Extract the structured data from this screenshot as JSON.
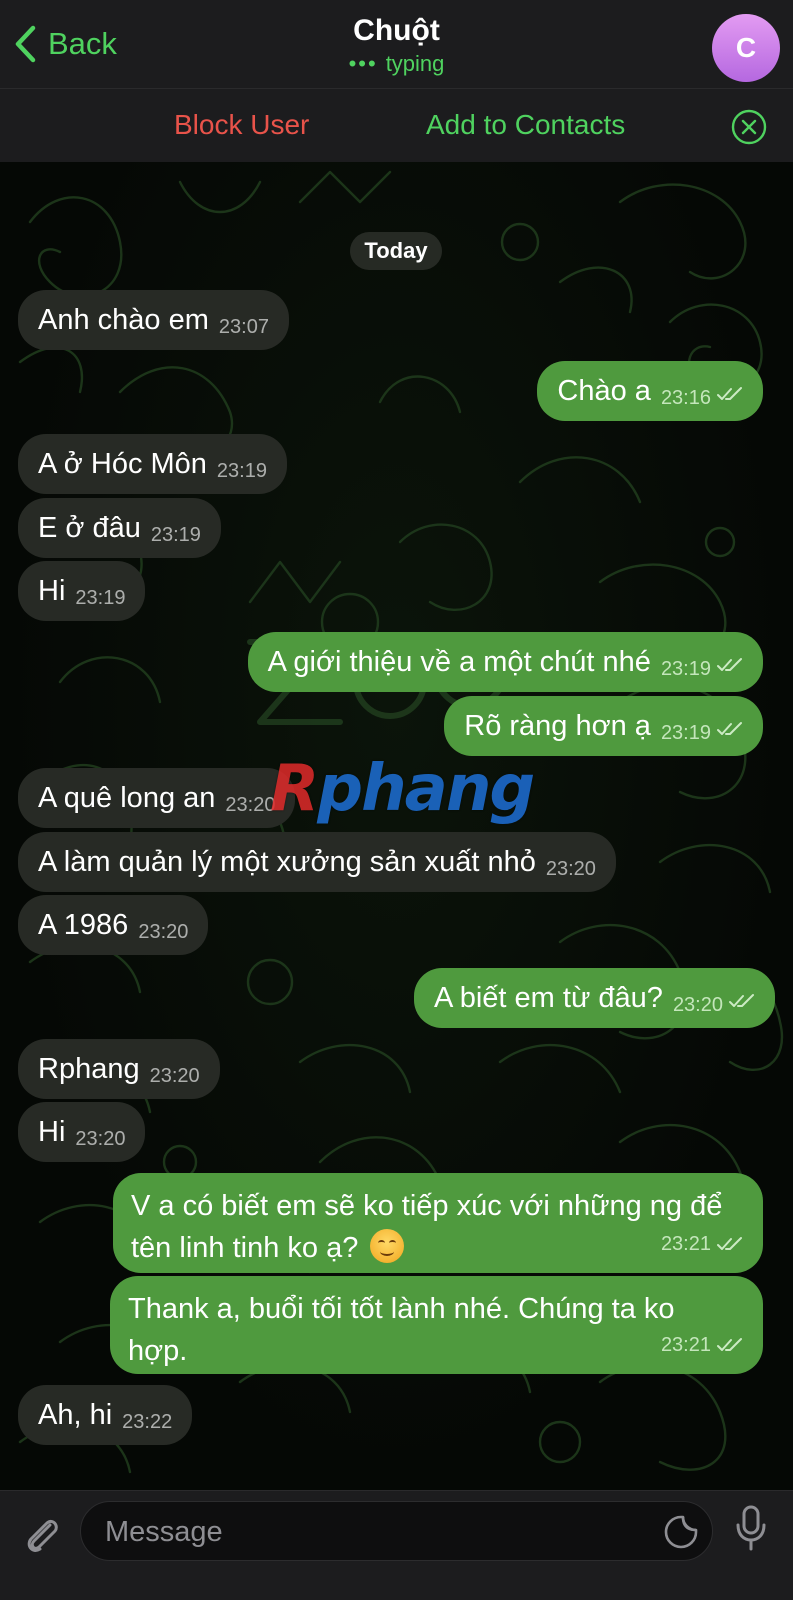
{
  "header": {
    "back_label": "Back",
    "contact_name": "Chuột",
    "status_dots": "•••",
    "status": "typing",
    "avatar_initial": "C"
  },
  "action_bar": {
    "block_label": "Block User",
    "add_label": "Add to Contacts"
  },
  "chat": {
    "date_label": "Today",
    "watermark": {
      "first": "R",
      "rest": "phang"
    },
    "messages": [
      {
        "dir": "in",
        "text": "Anh chào em",
        "time": "23:07"
      },
      {
        "dir": "out",
        "text": "Chào a",
        "time": "23:16",
        "read": true
      },
      {
        "dir": "in",
        "text": "A ở Hóc Môn",
        "time": "23:19"
      },
      {
        "dir": "in",
        "text": "E ở đâu",
        "time": "23:19"
      },
      {
        "dir": "in",
        "text": "Hi",
        "time": "23:19"
      },
      {
        "dir": "out",
        "text": "A giới thiệu về a một chút nhé",
        "time": "23:19",
        "read": true
      },
      {
        "dir": "out",
        "text": "Rõ ràng hơn ạ",
        "time": "23:19",
        "read": true
      },
      {
        "dir": "in",
        "text": "A quê long an",
        "time": "23:20"
      },
      {
        "dir": "in",
        "text": "A làm quản lý một xưởng sản xuất nhỏ",
        "time": "23:20"
      },
      {
        "dir": "in",
        "text": "A 1986",
        "time": "23:20"
      },
      {
        "dir": "out",
        "text": "A biết em từ đâu?",
        "time": "23:20",
        "read": true
      },
      {
        "dir": "in",
        "text": "Rphang",
        "time": "23:20"
      },
      {
        "dir": "in",
        "text": "Hi",
        "time": "23:20"
      },
      {
        "dir": "out",
        "text": "V a có biết em sẽ ko tiếp xúc với những ng để tên linh tinh ko ạ?",
        "emoji": "smiling-face-icon",
        "time": "23:21",
        "read": true
      },
      {
        "dir": "out",
        "text": "Thank a, buổi tối tốt lành nhé. Chúng ta ko hợp.",
        "time": "23:21",
        "read": true
      },
      {
        "dir": "in",
        "text": "Ah, hi",
        "time": "23:22"
      }
    ]
  },
  "input": {
    "placeholder": "Message"
  },
  "colors": {
    "accent": "#4fd25f",
    "danger": "#e8534a",
    "outgoing_bubble": "#4f9a3e",
    "incoming_bubble": "#272a25",
    "bar_background": "#1c1c1e"
  },
  "icons": {
    "back": "chevron-left-icon",
    "close": "close-circle-icon",
    "attach": "paperclip-icon",
    "sticker": "sticker-icon",
    "mic": "microphone-icon",
    "read": "double-check-icon"
  }
}
